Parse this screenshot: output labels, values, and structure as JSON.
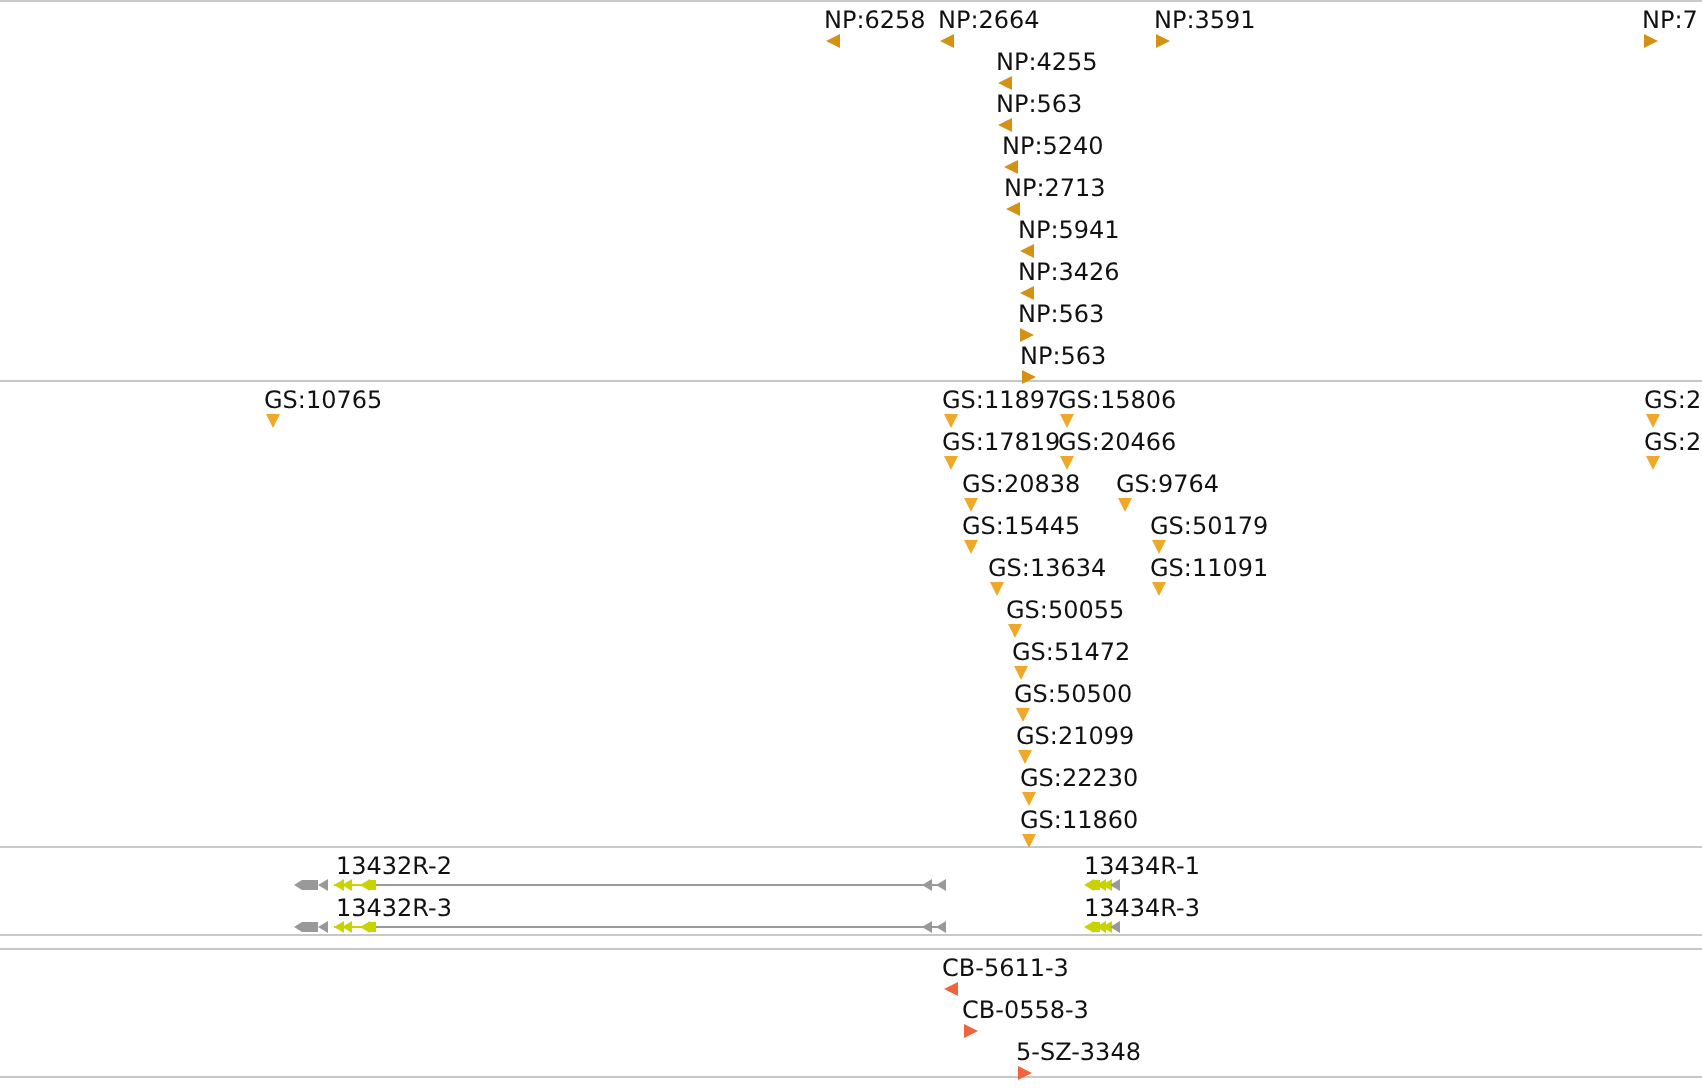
{
  "tracks": [
    {
      "kind": "markers",
      "color": "#d49214",
      "features": [
        {
          "label": "NP:6258",
          "kind": "left"
        },
        {
          "label": "NP:2664",
          "kind": "left"
        },
        {
          "label": "NP:3591",
          "kind": "right"
        },
        {
          "label": "NP:7",
          "kind": "right"
        },
        {
          "label": "NP:4255",
          "kind": "left"
        },
        {
          "label": "NP:563",
          "kind": "left"
        },
        {
          "label": "NP:5240",
          "kind": "left"
        },
        {
          "label": "NP:2713",
          "kind": "left"
        },
        {
          "label": "NP:5941",
          "kind": "left"
        },
        {
          "label": "NP:3426",
          "kind": "left"
        },
        {
          "label": "NP:563",
          "kind": "right"
        },
        {
          "label": "NP:563",
          "kind": "right"
        }
      ]
    },
    {
      "kind": "markers",
      "color": "#f0a828",
      "features": [
        {
          "label": "GS:10765",
          "kind": "down"
        },
        {
          "label": "GS:11897",
          "kind": "down"
        },
        {
          "label": "GS:15806",
          "kind": "down"
        },
        {
          "label": "GS:2",
          "kind": "down"
        },
        {
          "label": "GS:17819",
          "kind": "down"
        },
        {
          "label": "GS:20466",
          "kind": "down"
        },
        {
          "label": "GS:2",
          "kind": "down"
        },
        {
          "label": "GS:20838",
          "kind": "down"
        },
        {
          "label": "GS:9764",
          "kind": "down"
        },
        {
          "label": "GS:15445",
          "kind": "down"
        },
        {
          "label": "GS:50179",
          "kind": "down"
        },
        {
          "label": "GS:13634",
          "kind": "down"
        },
        {
          "label": "GS:11091",
          "kind": "down"
        },
        {
          "label": "GS:50055",
          "kind": "down"
        },
        {
          "label": "GS:51472",
          "kind": "down"
        },
        {
          "label": "GS:50500",
          "kind": "down"
        },
        {
          "label": "GS:21099",
          "kind": "down"
        },
        {
          "label": "GS:22230",
          "kind": "down"
        },
        {
          "label": "GS:11860",
          "kind": "down"
        }
      ]
    },
    {
      "kind": "transcripts",
      "features": [
        {
          "label": "13432R-2"
        },
        {
          "label": "13434R-1"
        },
        {
          "label": "13432R-3"
        },
        {
          "label": "13434R-3"
        }
      ]
    },
    {
      "kind": "markers",
      "color": "#f0643c",
      "features": [
        {
          "label": "CB-5611-3",
          "kind": "left"
        },
        {
          "label": "CB-0558-3",
          "kind": "right"
        },
        {
          "label": "5-SZ-3348",
          "kind": "right"
        }
      ]
    }
  ]
}
